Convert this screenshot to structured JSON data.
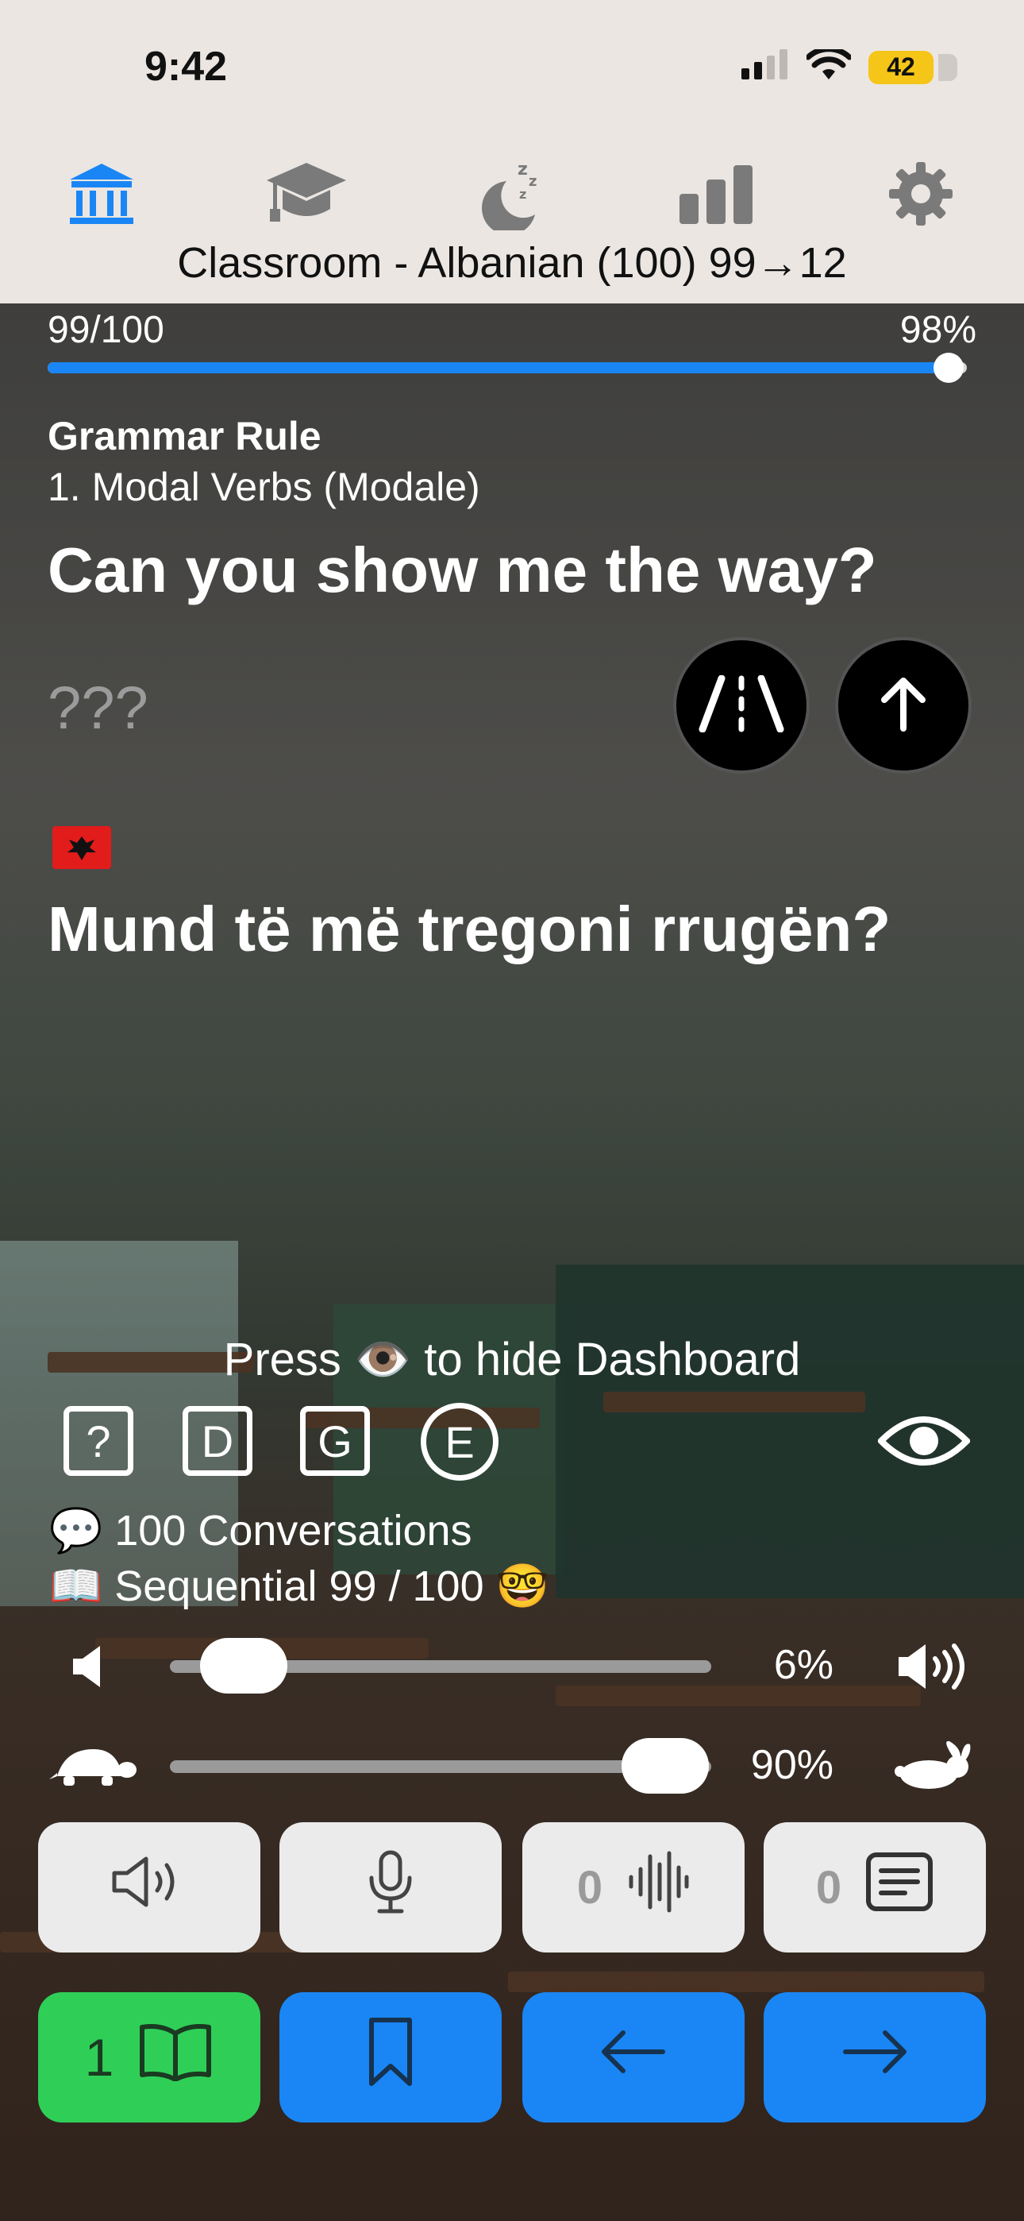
{
  "status": {
    "time": "9:42",
    "battery": "42"
  },
  "nav": {
    "icons": [
      "classroom-icon",
      "graduation-cap-icon",
      "sleep-icon",
      "stats-icon",
      "gear-icon"
    ],
    "title": "Classroom - Albanian (100) 99→12"
  },
  "progress": {
    "left_label": "99/100",
    "right_label": "98%",
    "fraction": 0.98
  },
  "lesson": {
    "section": "Grammar Rule",
    "subtitle": "1. Modal Verbs (Modale)",
    "question": "Can you show me the way?",
    "answer_placeholder": "???",
    "translation": "Mund të më tregoni rrugën?"
  },
  "dashboard": {
    "hint": "Press 👁️ to hide Dashboard",
    "modes": [
      "?",
      "D",
      "G",
      "E"
    ],
    "conversations": "💬 100 Conversations",
    "sequential": "📖 Sequential 99  /  100 🤓"
  },
  "sliders": {
    "volume": {
      "value": "6%",
      "fraction": 0.06
    },
    "speed": {
      "value": "90%",
      "fraction": 0.9
    }
  },
  "actions": {
    "row1": [
      {
        "icon": "speaker-icon",
        "count": ""
      },
      {
        "icon": "microphone-icon",
        "count": ""
      },
      {
        "icon": "waveform-icon",
        "count": "0"
      },
      {
        "icon": "document-icon",
        "count": "0"
      }
    ],
    "row2": [
      {
        "icon": "book-icon",
        "count": "1"
      },
      {
        "icon": "bookmark-icon",
        "count": ""
      },
      {
        "icon": "arrow-left-icon",
        "count": ""
      },
      {
        "icon": "arrow-right-icon",
        "count": ""
      }
    ]
  },
  "colors": {
    "accent_blue": "#1a86f5",
    "accent_green": "#2fcf57",
    "header_bg": "#ebe6e2",
    "battery": "#f5c518"
  }
}
